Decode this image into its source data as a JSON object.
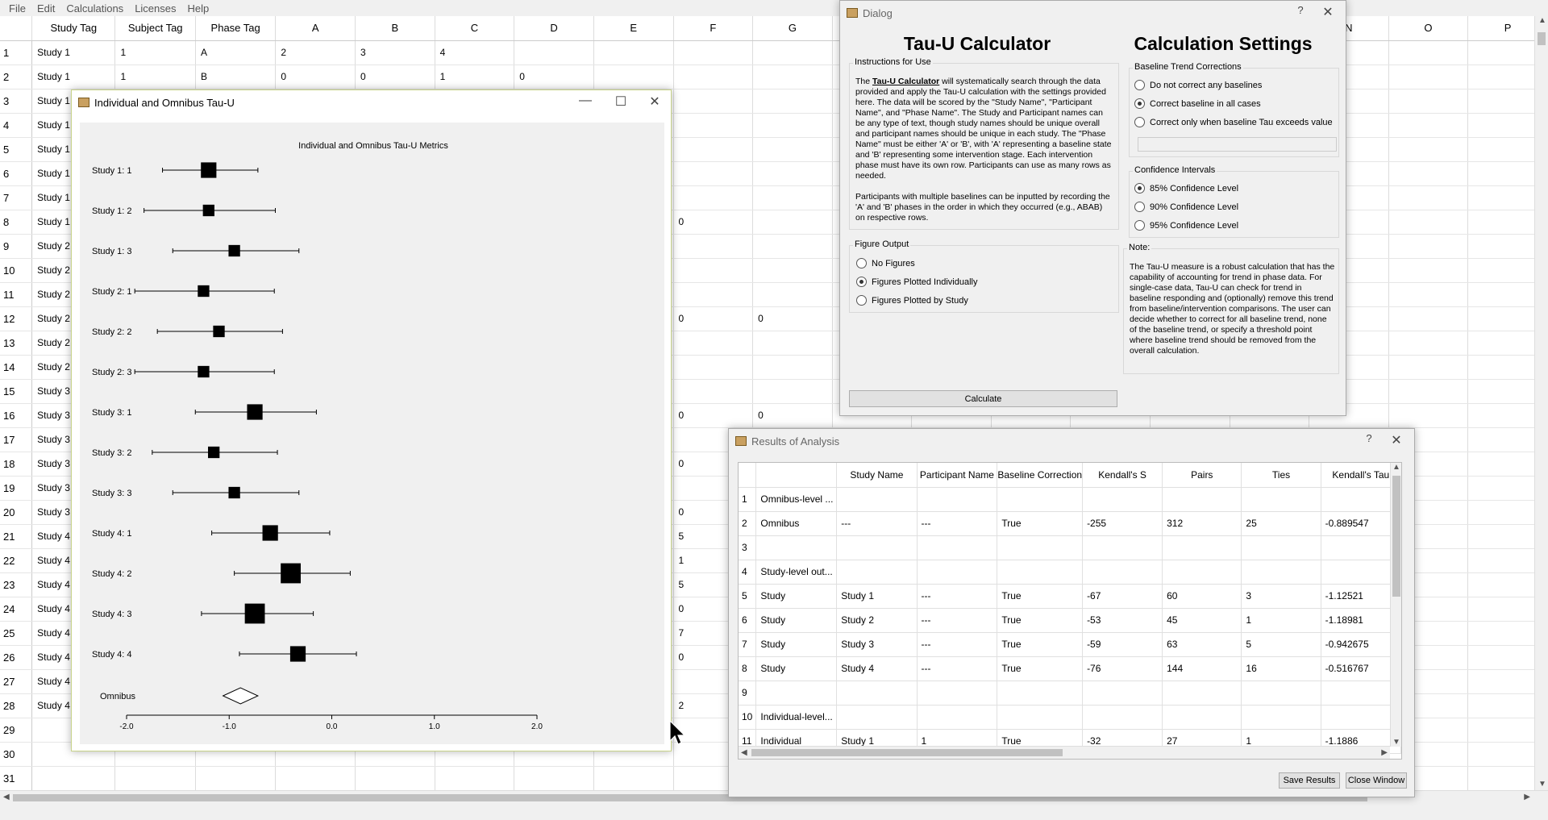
{
  "menu": [
    "File",
    "Edit",
    "Calculations",
    "Licenses",
    "Help"
  ],
  "sheet": {
    "columns": [
      "Study Tag",
      "Subject Tag",
      "Phase Tag",
      "A",
      "B",
      "C",
      "D",
      "E",
      "F",
      "G",
      "",
      "",
      "",
      "",
      "",
      "",
      "N",
      "O",
      "P"
    ],
    "rows": [
      [
        "1",
        "Study 1",
        "1",
        "A",
        "2",
        "3",
        "4",
        "",
        "",
        "",
        ""
      ],
      [
        "2",
        "Study 1",
        "1",
        "B",
        "0",
        "0",
        "1",
        "0",
        "",
        "",
        ""
      ],
      [
        "3",
        "Study 1",
        "",
        "",
        "",
        "",
        "",
        "",
        "",
        "",
        ""
      ],
      [
        "4",
        "Study 1",
        "",
        "",
        "",
        "",
        "",
        "",
        "",
        "",
        ""
      ],
      [
        "5",
        "Study 1",
        "",
        "",
        "",
        "",
        "",
        "",
        "",
        "",
        ""
      ],
      [
        "6",
        "Study 1",
        "",
        "",
        "",
        "",
        "",
        "",
        "",
        "",
        ""
      ],
      [
        "7",
        "Study 1",
        "",
        "",
        "",
        "",
        "",
        "",
        "",
        "",
        ""
      ],
      [
        "8",
        "Study 1",
        "",
        "",
        "",
        "",
        "",
        "",
        "",
        "0",
        ""
      ],
      [
        "9",
        "Study 2",
        "",
        "",
        "",
        "",
        "",
        "",
        "",
        "",
        ""
      ],
      [
        "10",
        "Study 2",
        "",
        "",
        "",
        "",
        "",
        "",
        "",
        "",
        ""
      ],
      [
        "11",
        "Study 2",
        "",
        "",
        "",
        "",
        "",
        "",
        "",
        "",
        ""
      ],
      [
        "12",
        "Study 2",
        "",
        "",
        "",
        "",
        "",
        "",
        "",
        "0",
        "0"
      ],
      [
        "13",
        "Study 2",
        "",
        "",
        "",
        "",
        "",
        "",
        "",
        "",
        ""
      ],
      [
        "14",
        "Study 2",
        "",
        "",
        "",
        "",
        "",
        "",
        "",
        "",
        ""
      ],
      [
        "15",
        "Study 3",
        "",
        "",
        "",
        "",
        "",
        "",
        "",
        "",
        ""
      ],
      [
        "16",
        "Study 3",
        "",
        "",
        "",
        "",
        "",
        "",
        "",
        "0",
        "0"
      ],
      [
        "17",
        "Study 3",
        "",
        "",
        "",
        "",
        "",
        "",
        "",
        "",
        ""
      ],
      [
        "18",
        "Study 3",
        "",
        "",
        "",
        "",
        "",
        "",
        "",
        "0",
        ""
      ],
      [
        "19",
        "Study 3",
        "",
        "",
        "",
        "",
        "",
        "",
        "",
        "",
        ""
      ],
      [
        "20",
        "Study 3",
        "",
        "",
        "",
        "",
        "",
        "",
        "",
        "0",
        ""
      ],
      [
        "21",
        "Study 4",
        "",
        "",
        "",
        "",
        "",
        "",
        "",
        "5",
        ""
      ],
      [
        "22",
        "Study 4",
        "",
        "",
        "",
        "",
        "",
        "",
        "",
        "1",
        ""
      ],
      [
        "23",
        "Study 4",
        "",
        "",
        "",
        "",
        "",
        "",
        "",
        "5",
        ""
      ],
      [
        "24",
        "Study 4",
        "",
        "",
        "",
        "",
        "",
        "",
        "",
        "0",
        ""
      ],
      [
        "25",
        "Study 4",
        "",
        "",
        "",
        "",
        "",
        "",
        "",
        "7",
        ""
      ],
      [
        "26",
        "Study 4",
        "",
        "",
        "",
        "",
        "",
        "",
        "",
        "0",
        ""
      ],
      [
        "27",
        "Study 4",
        "",
        "",
        "",
        "",
        "",
        "",
        "",
        "",
        ""
      ],
      [
        "28",
        "Study 4",
        "",
        "",
        "",
        "",
        "",
        "",
        "",
        "2",
        ""
      ],
      [
        "29",
        "",
        "",
        "",
        "",
        "",
        "",
        "",
        "",
        "",
        ""
      ],
      [
        "30",
        "",
        "",
        "",
        "",
        "",
        "",
        "",
        "",
        "",
        ""
      ],
      [
        "31",
        "",
        "",
        "",
        "",
        "",
        "",
        "",
        "",
        "",
        ""
      ]
    ]
  },
  "plot_window": {
    "title": "Individual and Omnibus Tau-U"
  },
  "chart_data": {
    "type": "forest",
    "title": "Individual and Omnibus Tau-U Metrics",
    "xlim": [
      -2.0,
      2.0
    ],
    "xticks": [
      "-2.0",
      "-1.0",
      "0.0",
      "1.0",
      "2.0"
    ],
    "rows": [
      {
        "label": "Study 1: 1",
        "est": -1.2,
        "lo": -1.65,
        "hi": -0.72,
        "weight": 0.8
      },
      {
        "label": "Study 1: 2",
        "est": -1.2,
        "lo": -1.83,
        "hi": -0.55,
        "weight": 0.45
      },
      {
        "label": "Study 1: 3",
        "est": -0.95,
        "lo": -1.55,
        "hi": -0.32,
        "weight": 0.45
      },
      {
        "label": "Study 2: 1",
        "est": -1.25,
        "lo": -1.92,
        "hi": -0.56,
        "weight": 0.45
      },
      {
        "label": "Study 2: 2",
        "est": -1.1,
        "lo": -1.7,
        "hi": -0.48,
        "weight": 0.45
      },
      {
        "label": "Study 2: 3",
        "est": -1.25,
        "lo": -1.92,
        "hi": -0.56,
        "weight": 0.45
      },
      {
        "label": "Study 3: 1",
        "est": -0.75,
        "lo": -1.33,
        "hi": -0.15,
        "weight": 0.8
      },
      {
        "label": "Study 3: 2",
        "est": -1.15,
        "lo": -1.75,
        "hi": -0.53,
        "weight": 0.45
      },
      {
        "label": "Study 3: 3",
        "est": -0.95,
        "lo": -1.55,
        "hi": -0.32,
        "weight": 0.45
      },
      {
        "label": "Study 4: 1",
        "est": -0.6,
        "lo": -1.17,
        "hi": -0.02,
        "weight": 0.8
      },
      {
        "label": "Study 4: 2",
        "est": -0.4,
        "lo": -0.95,
        "hi": 0.18,
        "weight": 1.2
      },
      {
        "label": "Study 4: 3",
        "est": -0.75,
        "lo": -1.27,
        "hi": -0.18,
        "weight": 1.2
      },
      {
        "label": "Study 4: 4",
        "est": -0.33,
        "lo": -0.9,
        "hi": 0.24,
        "weight": 0.8
      }
    ],
    "omnibus": {
      "label": "Omnibus",
      "est": -0.89,
      "lo": -1.06,
      "hi": -0.72
    }
  },
  "dialog": {
    "title": "Dialog",
    "heading_left": "Tau-U Calculator",
    "heading_right": "Calculation Settings",
    "instructions_title": "Instructions for Use",
    "instructions_bold": "Tau-U Calculator",
    "instructions_pre": "The ",
    "instructions_p1": " will systematically search through the data provided and apply the Tau-U calculation with the settings provided here. The data will be scored by the \"Study Name\", \"Participant Name\", and \"Phase Name\". The Study and Participant names can be any type of text, though study names should be unique overall and participant names should be unique in each study. The \"Phase Name\" must be either 'A' or 'B', with 'A' representing a baseline state and 'B' representing some intervention stage. Each intervention phase must have its own row. Participants can use as many rows as needed.",
    "instructions_p2": "Participants with multiple baselines can be inputted by recording the 'A' and 'B' phases in the order in which they occurred (e.g., ABAB) on respective rows.",
    "figure_title": "Figure Output",
    "figure_options": [
      "No Figures",
      "Figures Plotted Individually",
      "Figures Plotted by Study"
    ],
    "figure_selected": 1,
    "baseline_title": "Baseline Trend Corrections",
    "baseline_options": [
      "Do not correct any baselines",
      "Correct baseline in all cases",
      "Correct only when baseline Tau exceeds value"
    ],
    "baseline_selected": 1,
    "ci_title": "Confidence Intervals",
    "ci_options": [
      "85% Confidence Level",
      "90% Confidence Level",
      "95% Confidence Level"
    ],
    "ci_selected": 0,
    "note_title": "Note:",
    "note_text": "The Tau-U measure is a robust calculation that has the capability of accounting for trend in phase data. For single-case data, Tau-U can check for trend in baseline responding and (optionally) remove this trend from baseline/intervention comparisons. The user can decide whether to correct for all baseline trend, none of the baseline trend, or specify a threshold point where baseline trend should be removed from the overall calculation.",
    "calculate_label": "Calculate"
  },
  "results": {
    "title": "Results of Analysis",
    "headers": [
      "",
      "",
      "Study Name",
      "Participant Name",
      "Baseline Correction",
      "Kendall's S",
      "Pairs",
      "Ties",
      "Kendall's Tau"
    ],
    "rows": [
      [
        "1",
        "Omnibus-level ...",
        "",
        "",
        "",
        "",
        "",
        "",
        ""
      ],
      [
        "2",
        "Omnibus",
        "---",
        "---",
        "True",
        "-255",
        "312",
        "25",
        "-0.889547"
      ],
      [
        "3",
        "",
        "",
        "",
        "",
        "",
        "",
        "",
        ""
      ],
      [
        "4",
        "Study-level out...",
        "",
        "",
        "",
        "",
        "",
        "",
        ""
      ],
      [
        "5",
        "Study",
        "Study 1",
        "---",
        "True",
        "-67",
        "60",
        "3",
        "-1.12521"
      ],
      [
        "6",
        "Study",
        "Study 2",
        "---",
        "True",
        "-53",
        "45",
        "1",
        "-1.18981"
      ],
      [
        "7",
        "Study",
        "Study 3",
        "---",
        "True",
        "-59",
        "63",
        "5",
        "-0.942675"
      ],
      [
        "8",
        "Study",
        "Study 4",
        "---",
        "True",
        "-76",
        "144",
        "16",
        "-0.516767"
      ],
      [
        "9",
        "",
        "",
        "",
        "",
        "",
        "",
        "",
        ""
      ],
      [
        "10",
        "Individual-level...",
        "",
        "",
        "",
        "",
        "",
        "",
        ""
      ],
      [
        "11",
        "Individual",
        "Study 1",
        "1",
        "True",
        "-32",
        "27",
        "1",
        "-1.1886"
      ]
    ],
    "save_label": "Save Results",
    "close_label": "Close Window"
  }
}
